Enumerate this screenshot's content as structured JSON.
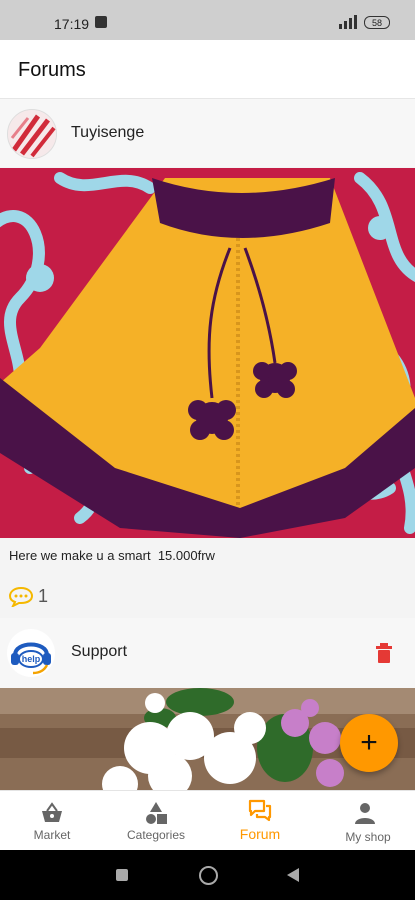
{
  "status_bar": {
    "time": "17:19",
    "battery": "58"
  },
  "app_bar": {
    "title": "Forums"
  },
  "posts": [
    {
      "author": "Tuyisenge",
      "caption": "Here we make u a smart  15.000frw",
      "comment_count": "1"
    },
    {
      "author": "Support"
    }
  ],
  "bottom_nav": {
    "items": [
      {
        "label": "Market",
        "icon": "basket-icon"
      },
      {
        "label": "Categories",
        "icon": "shapes-icon"
      },
      {
        "label": "Forum",
        "icon": "forum-icon"
      },
      {
        "label": "My shop",
        "icon": "person-icon"
      }
    ],
    "active_index": 2
  },
  "colors": {
    "accent": "#ff9800",
    "delete": "#e53935",
    "comment_icon": "#f5b800",
    "nav_inactive": "#666666"
  }
}
